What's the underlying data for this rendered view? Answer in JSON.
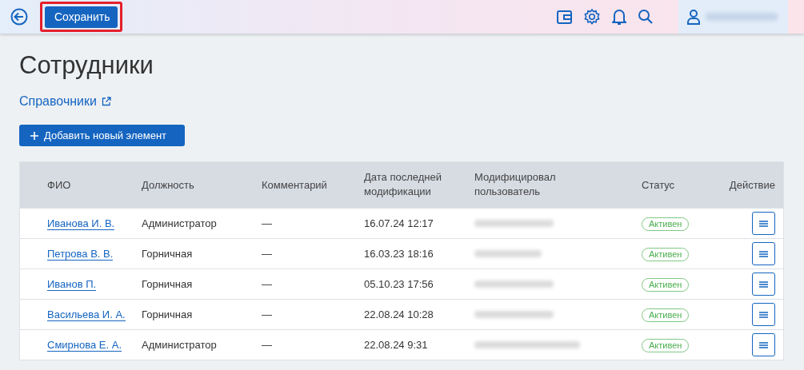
{
  "header": {
    "save_button": "Сохранить"
  },
  "page": {
    "title": "Сотрудники",
    "link": "Справочники",
    "add_button": "Добавить новый элемент"
  },
  "table": {
    "columns": [
      "ФИО",
      "Должность",
      "Комментарий",
      "Дата последней модификации",
      "Модифицировал пользователь",
      "Статус",
      "Действие"
    ],
    "rows": [
      {
        "name": "Иванова И. В.",
        "position": "Администратор",
        "comment": "—",
        "date": "16.07.24 12:17",
        "status": "Активен"
      },
      {
        "name": "Петрова В. В.",
        "position": "Горничная",
        "comment": "—",
        "date": "16.03.23 18:16",
        "status": "Активен"
      },
      {
        "name": "Иванов П.",
        "position": "Горничная",
        "comment": "—",
        "date": "05.10.23 17:56",
        "status": "Активен"
      },
      {
        "name": "Васильева И. А.",
        "position": "Горничная",
        "comment": "—",
        "date": "22.08.24 10:28",
        "status": "Активен"
      },
      {
        "name": "Смирнова Е. А.",
        "position": "Администратор",
        "comment": "—",
        "date": "22.08.24 9:31",
        "status": "Активен"
      }
    ]
  }
}
